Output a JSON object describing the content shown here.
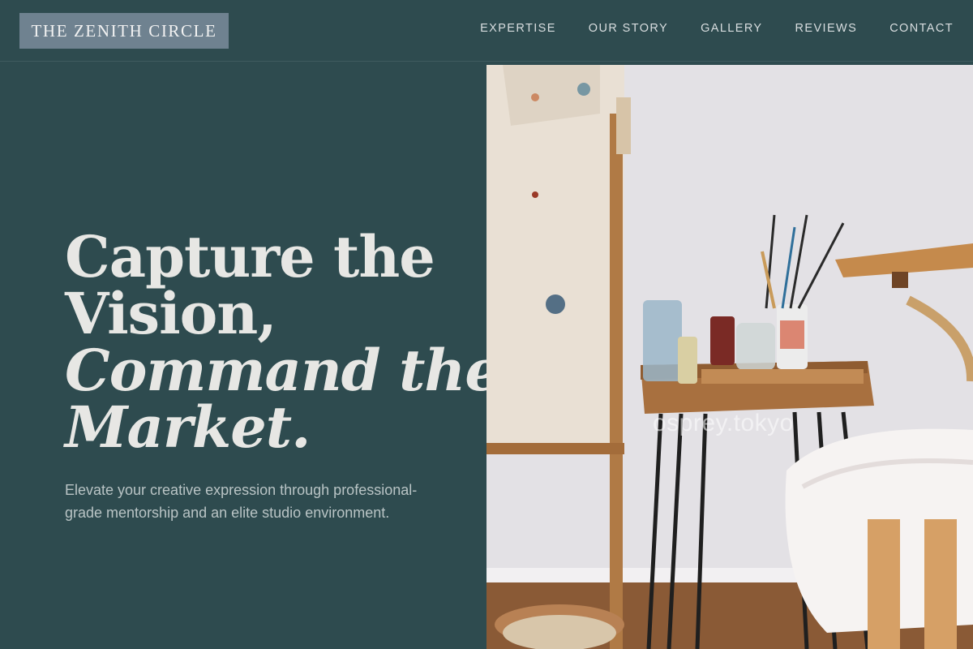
{
  "header": {
    "logo": "THE ZENITH CIRCLE",
    "nav": [
      "EXPERTISE",
      "OUR STORY",
      "GALLERY",
      "REVIEWS",
      "CONTACT"
    ]
  },
  "hero": {
    "line1": "Capture the",
    "line2": "Vision,",
    "line3": "Command the",
    "line4": "Market.",
    "subtitle": "Elevate your creative expression through professional-grade mentorship and an elite studio environment."
  },
  "photo": {
    "watermark": "osprey.tokyo"
  },
  "colors": {
    "background": "#2e4b4f",
    "logo_bg": "#6f8290",
    "headline": "#e7e7e4"
  }
}
